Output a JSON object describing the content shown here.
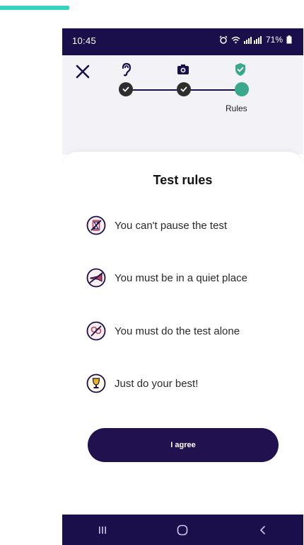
{
  "status_bar": {
    "time": "10:45",
    "battery": "71%",
    "icons": [
      "alarm-icon",
      "wifi-icon",
      "signal-icon",
      "battery-icon"
    ]
  },
  "stepper": {
    "steps": [
      {
        "icon": "ear-icon",
        "state": "done"
      },
      {
        "icon": "camera-icon",
        "state": "done"
      },
      {
        "icon": "shield-icon",
        "state": "active",
        "label": "Rules"
      }
    ]
  },
  "card": {
    "title": "Test rules",
    "rules": [
      {
        "icon": "hourglass-icon",
        "text": "You can't pause the test"
      },
      {
        "icon": "no-trumpet-icon",
        "text": "You must be in a quiet place"
      },
      {
        "icon": "no-people-icon",
        "text": "You must do the test alone"
      },
      {
        "icon": "trophy-icon",
        "text": "Just do your best!"
      }
    ],
    "agree_label": "I agree"
  },
  "colors": {
    "primary": "#22114f",
    "accent": "#3aa88c",
    "teal_bar": "#35d3c0",
    "icon_red": "#c0405a"
  }
}
